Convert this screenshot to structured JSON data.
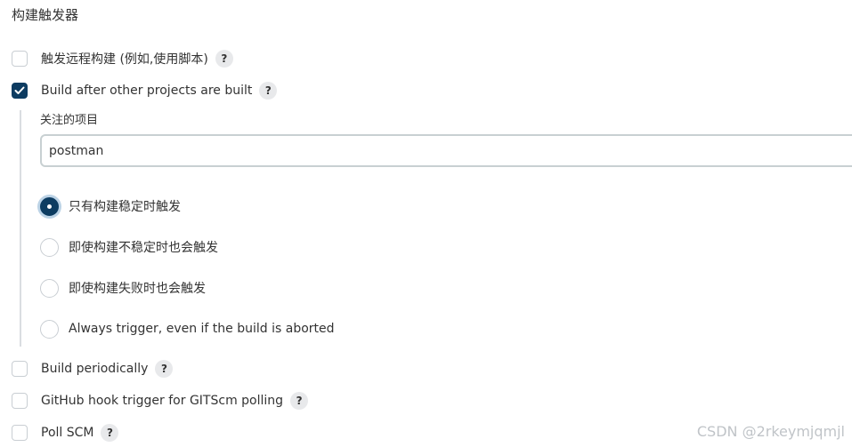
{
  "section_title": "构建触发器",
  "triggers": {
    "remote": {
      "label": "触发远程构建 (例如,使用脚本)",
      "checked": false,
      "help": "?"
    },
    "after_other": {
      "label": "Build after other projects are built",
      "checked": true,
      "help": "?"
    },
    "periodically": {
      "label": "Build periodically",
      "checked": false,
      "help": "?"
    },
    "github_hook": {
      "label": "GitHub hook trigger for GITScm polling",
      "checked": false,
      "help": "?"
    },
    "poll_scm": {
      "label": "Poll SCM",
      "checked": false,
      "help": "?"
    }
  },
  "watch_projects": {
    "label": "关注的项目",
    "value": "postman"
  },
  "trigger_condition": {
    "selected": "stable_only",
    "options": [
      {
        "id": "stable_only",
        "label": "只有构建稳定时触发"
      },
      {
        "id": "even_unstable",
        "label": "即使构建不稳定时也会触发"
      },
      {
        "id": "even_failed",
        "label": "即使构建失败时也会触发"
      },
      {
        "id": "always",
        "label": "Always trigger, even if the build is aborted"
      }
    ]
  },
  "watermark": "CSDN @2rkeymjqmjl",
  "colors": {
    "accent": "#0d3c61",
    "border": "#c9ced3",
    "help_bg": "#e8e9eb"
  }
}
